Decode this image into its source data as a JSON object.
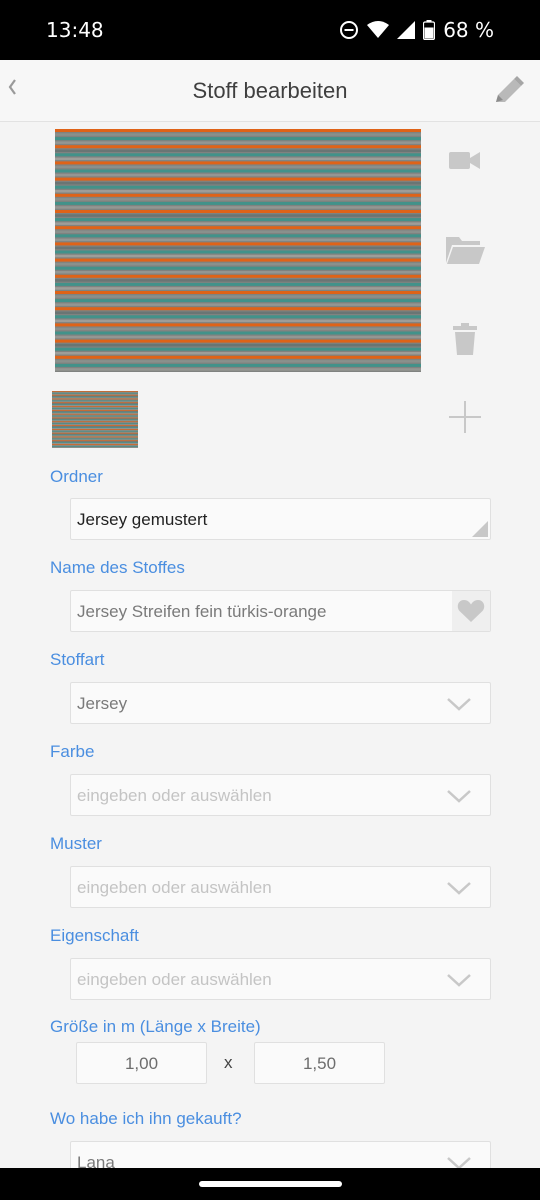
{
  "status_bar": {
    "time": "13:48",
    "battery": "68 %",
    "icons": [
      "do-not-disturb-icon",
      "wifi-icon",
      "signal-icon",
      "battery-icon"
    ]
  },
  "header": {
    "back_icon": "chevron-left-icon",
    "title": "Stoff bearbeiten",
    "edit_icon": "pencil-icon"
  },
  "media": {
    "photo": "striped-fabric-photo",
    "side_icons": [
      "video-camera-icon",
      "folder-icon",
      "trash-icon",
      "plus-icon"
    ]
  },
  "form": {
    "ordner": {
      "label": "Ordner",
      "value": "Jersey gemustert"
    },
    "name": {
      "label": "Name des Stoffes",
      "value": "Jersey Streifen fein türkis-orange",
      "favorite_icon": "heart-icon"
    },
    "stoffart": {
      "label": "Stoffart",
      "value": "Jersey"
    },
    "farbe": {
      "label": "Farbe",
      "placeholder": "eingeben oder auswählen"
    },
    "muster": {
      "label": "Muster",
      "placeholder": "eingeben oder auswählen"
    },
    "eigenschaft": {
      "label": "Eigenschaft",
      "placeholder": "eingeben oder auswählen"
    },
    "groesse": {
      "label": "Größe in m (Länge x Breite)",
      "laenge": "1,00",
      "separator": "x",
      "breite": "1,50"
    },
    "gekauft": {
      "label": "Wo habe ich ihn gekauft?",
      "value": "Lana"
    }
  },
  "colors": {
    "accent": "#4a8ee0",
    "icon_gray": "#c8c8c8",
    "stripe_orange": "#ff6a10",
    "stripe_teal": "#3aa49a"
  }
}
